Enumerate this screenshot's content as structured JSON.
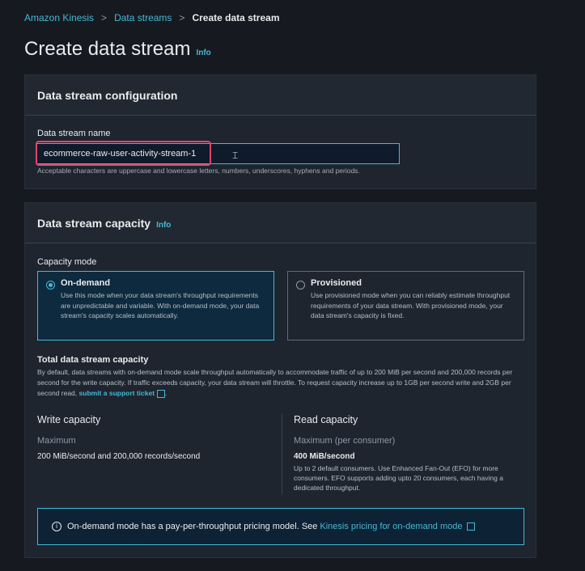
{
  "breadcrumb": {
    "root": "Amazon Kinesis",
    "parent": "Data streams",
    "current": "Create data stream",
    "separator": ">"
  },
  "page": {
    "title": "Create data stream",
    "info": "Info"
  },
  "config_panel": {
    "title": "Data stream configuration",
    "name_label": "Data stream name",
    "name_value": "ecommerce-raw-user-activity-stream-1",
    "name_hint": "Acceptable characters are uppercase and lowercase letters, numbers, underscores, hyphens and periods."
  },
  "capacity_panel": {
    "title": "Data stream capacity",
    "info": "Info",
    "mode_label": "Capacity mode",
    "modes": [
      {
        "title": "On-demand",
        "selected": true,
        "desc": "Use this mode when your data stream's throughput requirements are unpredictable and variable. With on-demand mode, your data stream's capacity scales automatically."
      },
      {
        "title": "Provisioned",
        "selected": false,
        "desc": "Use provisioned mode when you can reliably estimate throughput requirements of your data stream. With provisioned mode, your data stream's capacity is fixed."
      }
    ],
    "total_title": "Total data stream capacity",
    "total_desc": "By default, data streams with on-demand mode scale throughput automatically to accommodate traffic of up to 200 MiB per second and 200,000 records per second for the write capacity. If traffic exceeds capacity, your data stream will throttle. To request capacity increase up to 1GB per second write and 2GB per second read,",
    "support_link": "submit a support ticket",
    "write": {
      "title": "Write capacity",
      "sub": "Maximum",
      "value": "200 MiB/second and 200,000 records/second"
    },
    "read": {
      "title": "Read capacity",
      "sub": "Maximum (per consumer)",
      "value": "400 MiB/second",
      "desc": "Up to 2 default consumers. Use Enhanced Fan-Out (EFO) for more consumers. EFO supports adding upto 20 consumers, each having a dedicated throughput."
    },
    "pricing_note": "On-demand mode has a pay-per-throughput pricing model. See",
    "pricing_link": "Kinesis pricing for on-demand mode"
  },
  "colors": {
    "accent": "#44b9d6",
    "highlight": "#e5436a",
    "background": "#16191f"
  }
}
